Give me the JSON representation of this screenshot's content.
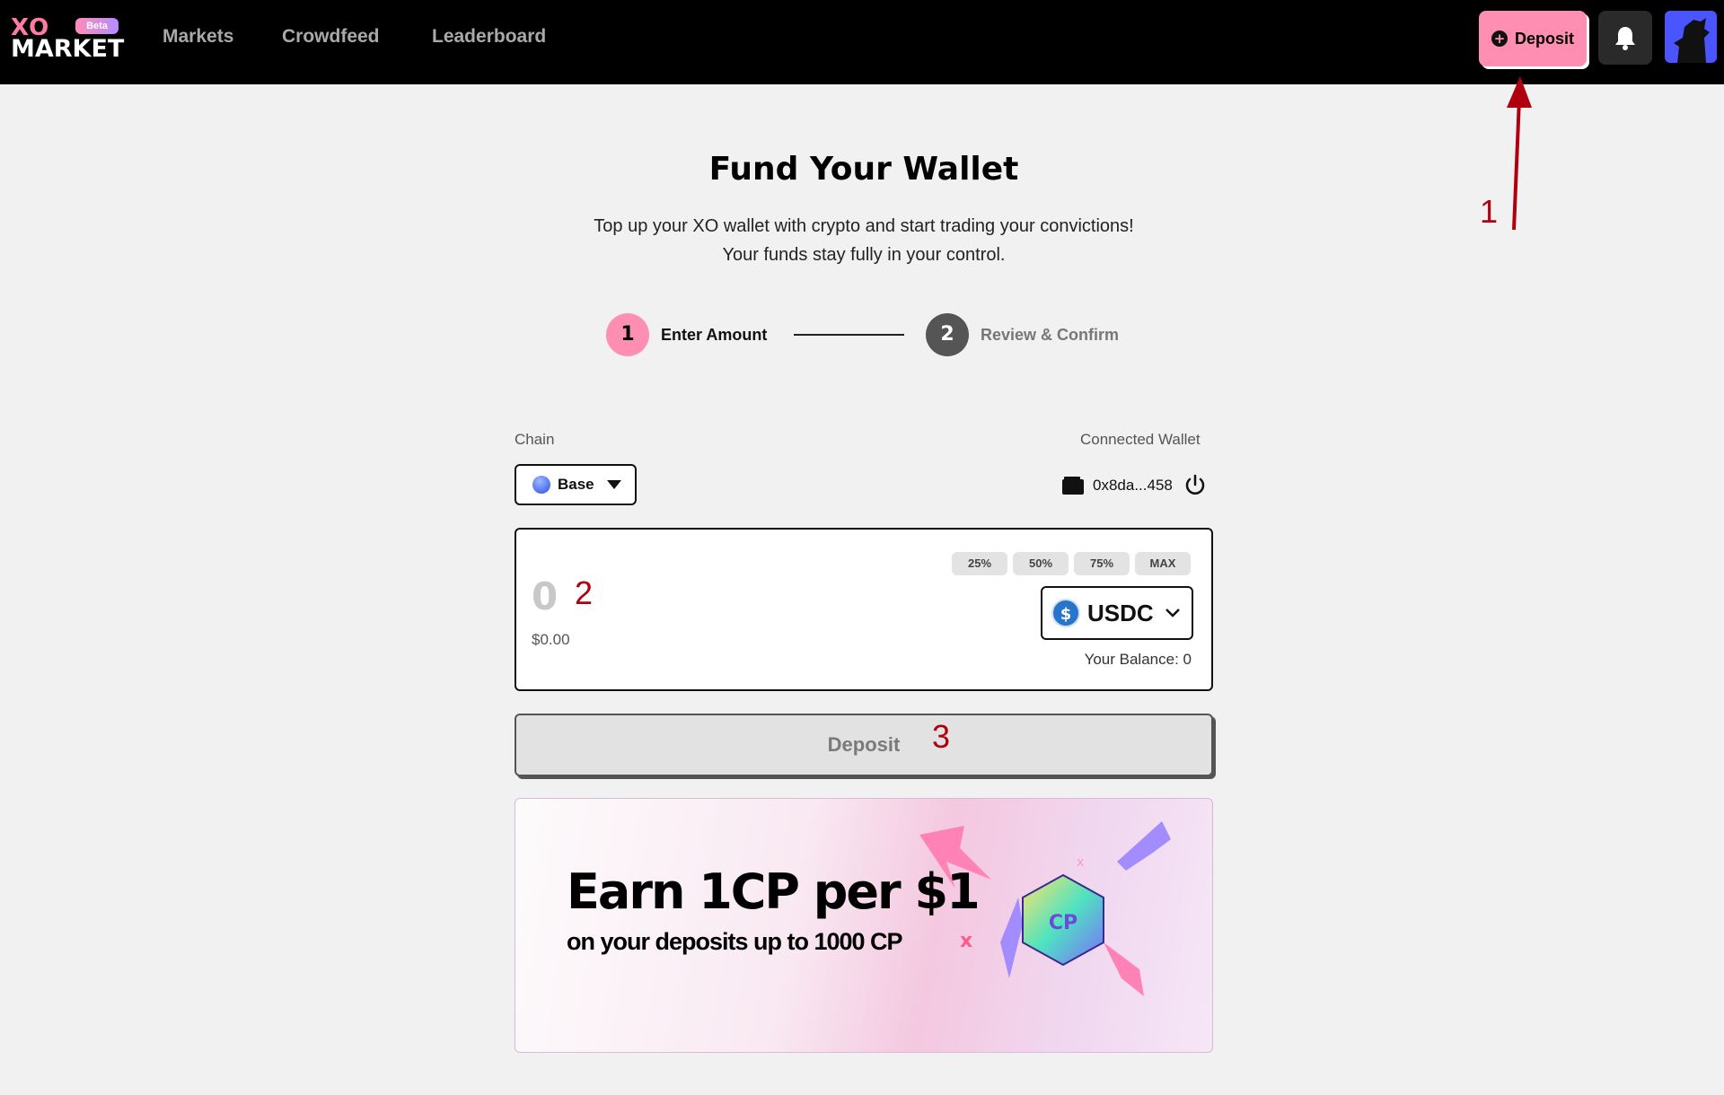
{
  "nav": {
    "logo_top": "XO",
    "logo_bottom": "MARKET",
    "logo_badge": "Beta",
    "links": [
      "Markets",
      "Crowdfeed",
      "Leaderboard"
    ],
    "deposit_label": "Deposit"
  },
  "page": {
    "title": "Fund Your Wallet",
    "subtitle_line1": "Top up your XO wallet with crypto and start trading your convictions!",
    "subtitle_line2": "Your funds stay fully in your control."
  },
  "steps": [
    {
      "number": "1",
      "label": "Enter Amount",
      "active": true
    },
    {
      "number": "2",
      "label": "Review & Confirm",
      "active": false
    }
  ],
  "form": {
    "chain_label": "Chain",
    "chain_value": "Base",
    "wallet_label": "Connected Wallet",
    "wallet_address": "0x8da...458",
    "percent_buttons": [
      "25%",
      "50%",
      "75%",
      "MAX"
    ],
    "amount_value": "0",
    "amount_usd": "$0.00",
    "token": "USDC",
    "balance_label": "Your Balance:",
    "balance_value": "0",
    "submit_label": "Deposit"
  },
  "banner": {
    "title": "Earn 1CP per $1",
    "subtitle": "on your deposits up to 1000 CP",
    "badge_text": "CP"
  },
  "annotations": [
    "1",
    "2",
    "3"
  ],
  "colors": {
    "accent_pink": "#ff8fb2",
    "nav_bg": "#000000",
    "annotation_red": "#b00010",
    "step_inactive": "#555555"
  }
}
